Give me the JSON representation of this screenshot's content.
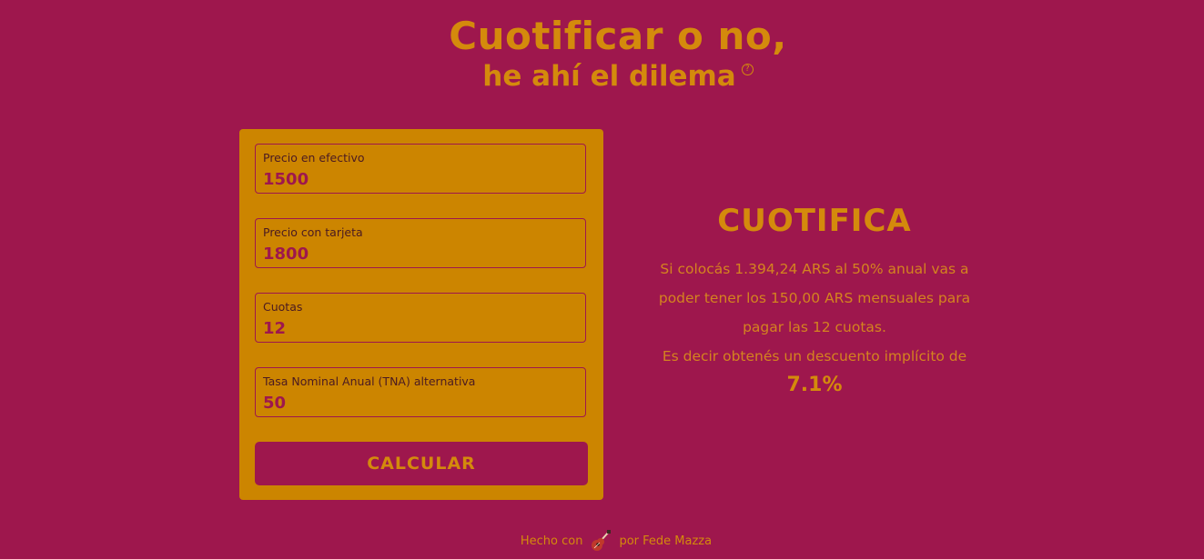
{
  "header": {
    "title": "Cuotificar o no,",
    "subtitle": "he ahí el dilema",
    "help_icon": "question-circle-icon"
  },
  "form": {
    "fields": [
      {
        "label": "Precio en efectivo",
        "value": "1500"
      },
      {
        "label": "Precio con tarjeta",
        "value": "1800"
      },
      {
        "label": "Cuotas",
        "value": "12"
      },
      {
        "label": "Tasa Nominal Anual (TNA) alternativa",
        "value": "50"
      }
    ],
    "button_label": "CALCULAR"
  },
  "result": {
    "title": "CUOTIFICA",
    "line1": "Si colocás 1.394,24 ARS al 50% anual vas a",
    "line2": "poder tener los 150,00 ARS mensuales para",
    "line3": "pagar las 12 cuotas.",
    "line4": "Es decir obtenés un descuento implícito de",
    "percentage": "7.1%"
  },
  "footer": {
    "prefix": "Hecho con",
    "icon": "guitar-icon",
    "suffix": "por Fede Mazza"
  },
  "colors": {
    "background": "#9e174d",
    "accent": "#d48a0c",
    "card": "#cc8500"
  }
}
